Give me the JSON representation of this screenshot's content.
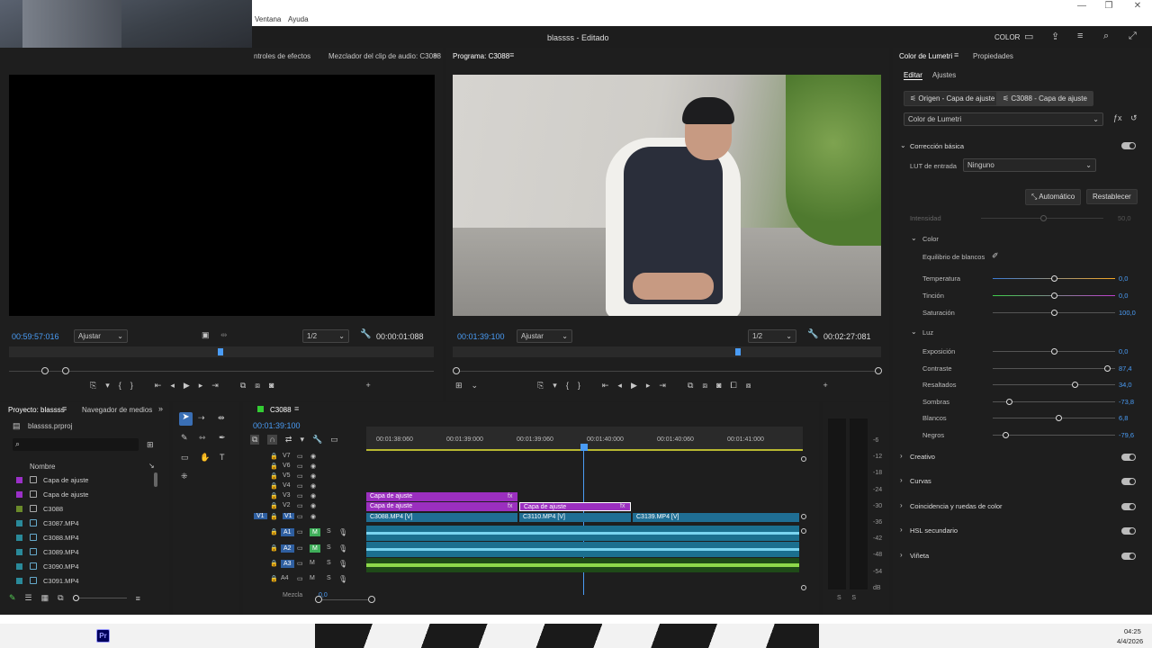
{
  "menu": {
    "ventana": "Ventana",
    "ayuda": "Ayuda"
  },
  "app": {
    "title": "blassss - Editado",
    "workspace": "COLOR"
  },
  "source_panel": {
    "tabs": [
      "ntroles de efectos",
      "Mezclador del clip de audio: C3088"
    ],
    "timecode_left": "00:59:57:016",
    "fit": "Ajustar",
    "res": "1/2",
    "timecode_right": "00:00:01:088"
  },
  "program_panel": {
    "tab": "Programa: C3088",
    "timecode_left": "00:01:39:100",
    "fit": "Ajustar",
    "res": "1/2",
    "timecode_right": "00:02:27:081"
  },
  "project_panel": {
    "tabs": [
      "Proyecto: blassss",
      "Navegador de medios"
    ],
    "file": "blassss.prproj",
    "col_name": "Nombre",
    "items": [
      {
        "name": "Capa de ajuste",
        "color": "#9b30c8",
        "type": "swatch"
      },
      {
        "name": "Capa de ajuste",
        "color": "#9b30c8",
        "type": "swatch"
      },
      {
        "name": "C3088",
        "color": "#6a8a2a",
        "type": "swatch"
      },
      {
        "name": "C3087.MP4",
        "color": "#2a8a9a",
        "type": "file"
      },
      {
        "name": "C3088.MP4",
        "color": "#2a8a9a",
        "type": "file"
      },
      {
        "name": "C3089.MP4",
        "color": "#2a8a9a",
        "type": "file"
      },
      {
        "name": "C3090.MP4",
        "color": "#2a8a9a",
        "type": "file"
      },
      {
        "name": "C3091.MP4",
        "color": "#2a8a9a",
        "type": "file"
      }
    ]
  },
  "timeline": {
    "tab": "C3088",
    "timecode": "00:01:39:100",
    "ruler": [
      "00:01:38:060",
      "00:01:39:000",
      "00:01:39:060",
      "00:01:40:000",
      "00:01:40:060",
      "00:01:41:000"
    ],
    "tracks_video": [
      "V7",
      "V6",
      "V5",
      "V4",
      "V3",
      "V2",
      "V1"
    ],
    "tracks_audio": [
      "A1",
      "A2",
      "A3",
      "A4"
    ],
    "mix": "Mezcla",
    "mix_val": "0,0",
    "clips": {
      "adj1": "Capa de ajuste",
      "adj2": "Capa de ajuste",
      "adj3": "Capa de ajuste",
      "v1a": "C3088.MP4 [V]",
      "v1b": "C3110.MP4 [V]",
      "v1c": "C3139.MP4 [V]"
    },
    "fx": "fx"
  },
  "meter": {
    "scale": [
      "-6",
      "-12",
      "-18",
      "-24",
      "-30",
      "-36",
      "-42",
      "-48",
      "-54",
      "dB"
    ],
    "ss": "S      S"
  },
  "lumetri": {
    "tabs": [
      "Color de Lumetri",
      "Propiedades"
    ],
    "subtabs": [
      "Editar",
      "Ajustes"
    ],
    "origin": "Origen - Capa de ajuste",
    "target": "C3088 - Capa de ajuste",
    "effect": "Color de Lumetri",
    "basic": "Corrección básica",
    "lut_label": "LUT de entrada",
    "lut_value": "Ninguno",
    "auto": "Automático",
    "reset": "Restablecer",
    "intensity": "Intensidad",
    "intensity_val": "50,0",
    "color": "Color",
    "wb": "Equilibrio de blancos",
    "temp": "Temperatura",
    "temp_val": "0,0",
    "tint": "Tinción",
    "tint_val": "0,0",
    "sat": "Saturación",
    "sat_val": "100,0",
    "light": "Luz",
    "exp": "Exposición",
    "exp_val": "0,0",
    "con": "Contraste",
    "con_val": "87,4",
    "hi": "Resaltados",
    "hi_val": "34,0",
    "sh": "Sombras",
    "sh_val": "-73,8",
    "wh": "Blancos",
    "wh_val": "6,8",
    "bl": "Negros",
    "bl_val": "-79,6",
    "sections": [
      "Creativo",
      "Curvas",
      "Coincidencia y ruedas de color",
      "HSL secundario",
      "Viñeta"
    ]
  },
  "taskbar": {
    "time": "04:25",
    "date": "4/4/2026"
  }
}
